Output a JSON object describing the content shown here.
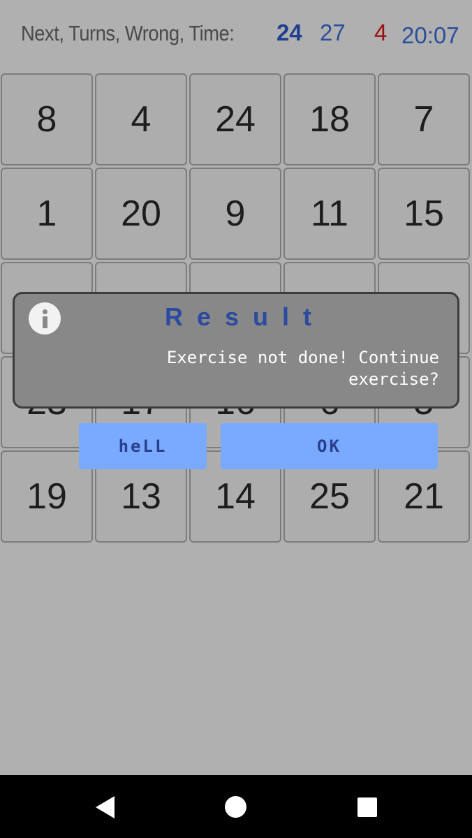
{
  "header": {
    "label": "Next, Turns, Wrong, Time:",
    "next": "24",
    "turns": "27",
    "wrong": "4",
    "time": "20:07"
  },
  "grid": {
    "row1": [
      "8",
      "4",
      "24",
      "18",
      "7"
    ],
    "row2": [
      "1",
      "20",
      "9",
      "11",
      "15"
    ],
    "row3": [
      "",
      "",
      "",
      "",
      ""
    ],
    "row4": [
      "23",
      "17",
      "16",
      "6",
      "5"
    ],
    "row5": [
      "19",
      "13",
      "14",
      "25",
      "21"
    ]
  },
  "dialog": {
    "icon": "info-icon",
    "title": "Result",
    "message": "Exercise not done! Continue exercise?",
    "buttons": {
      "negative": "heLL",
      "positive": "OK"
    }
  },
  "navbar": {
    "icons": [
      "back-icon",
      "home-icon",
      "recents-icon"
    ]
  },
  "colors": {
    "background": "#b0b0b0",
    "title_blue": "#2b4aa0",
    "wrong_red": "#9a1212",
    "button_blue": "#7aaaff"
  }
}
